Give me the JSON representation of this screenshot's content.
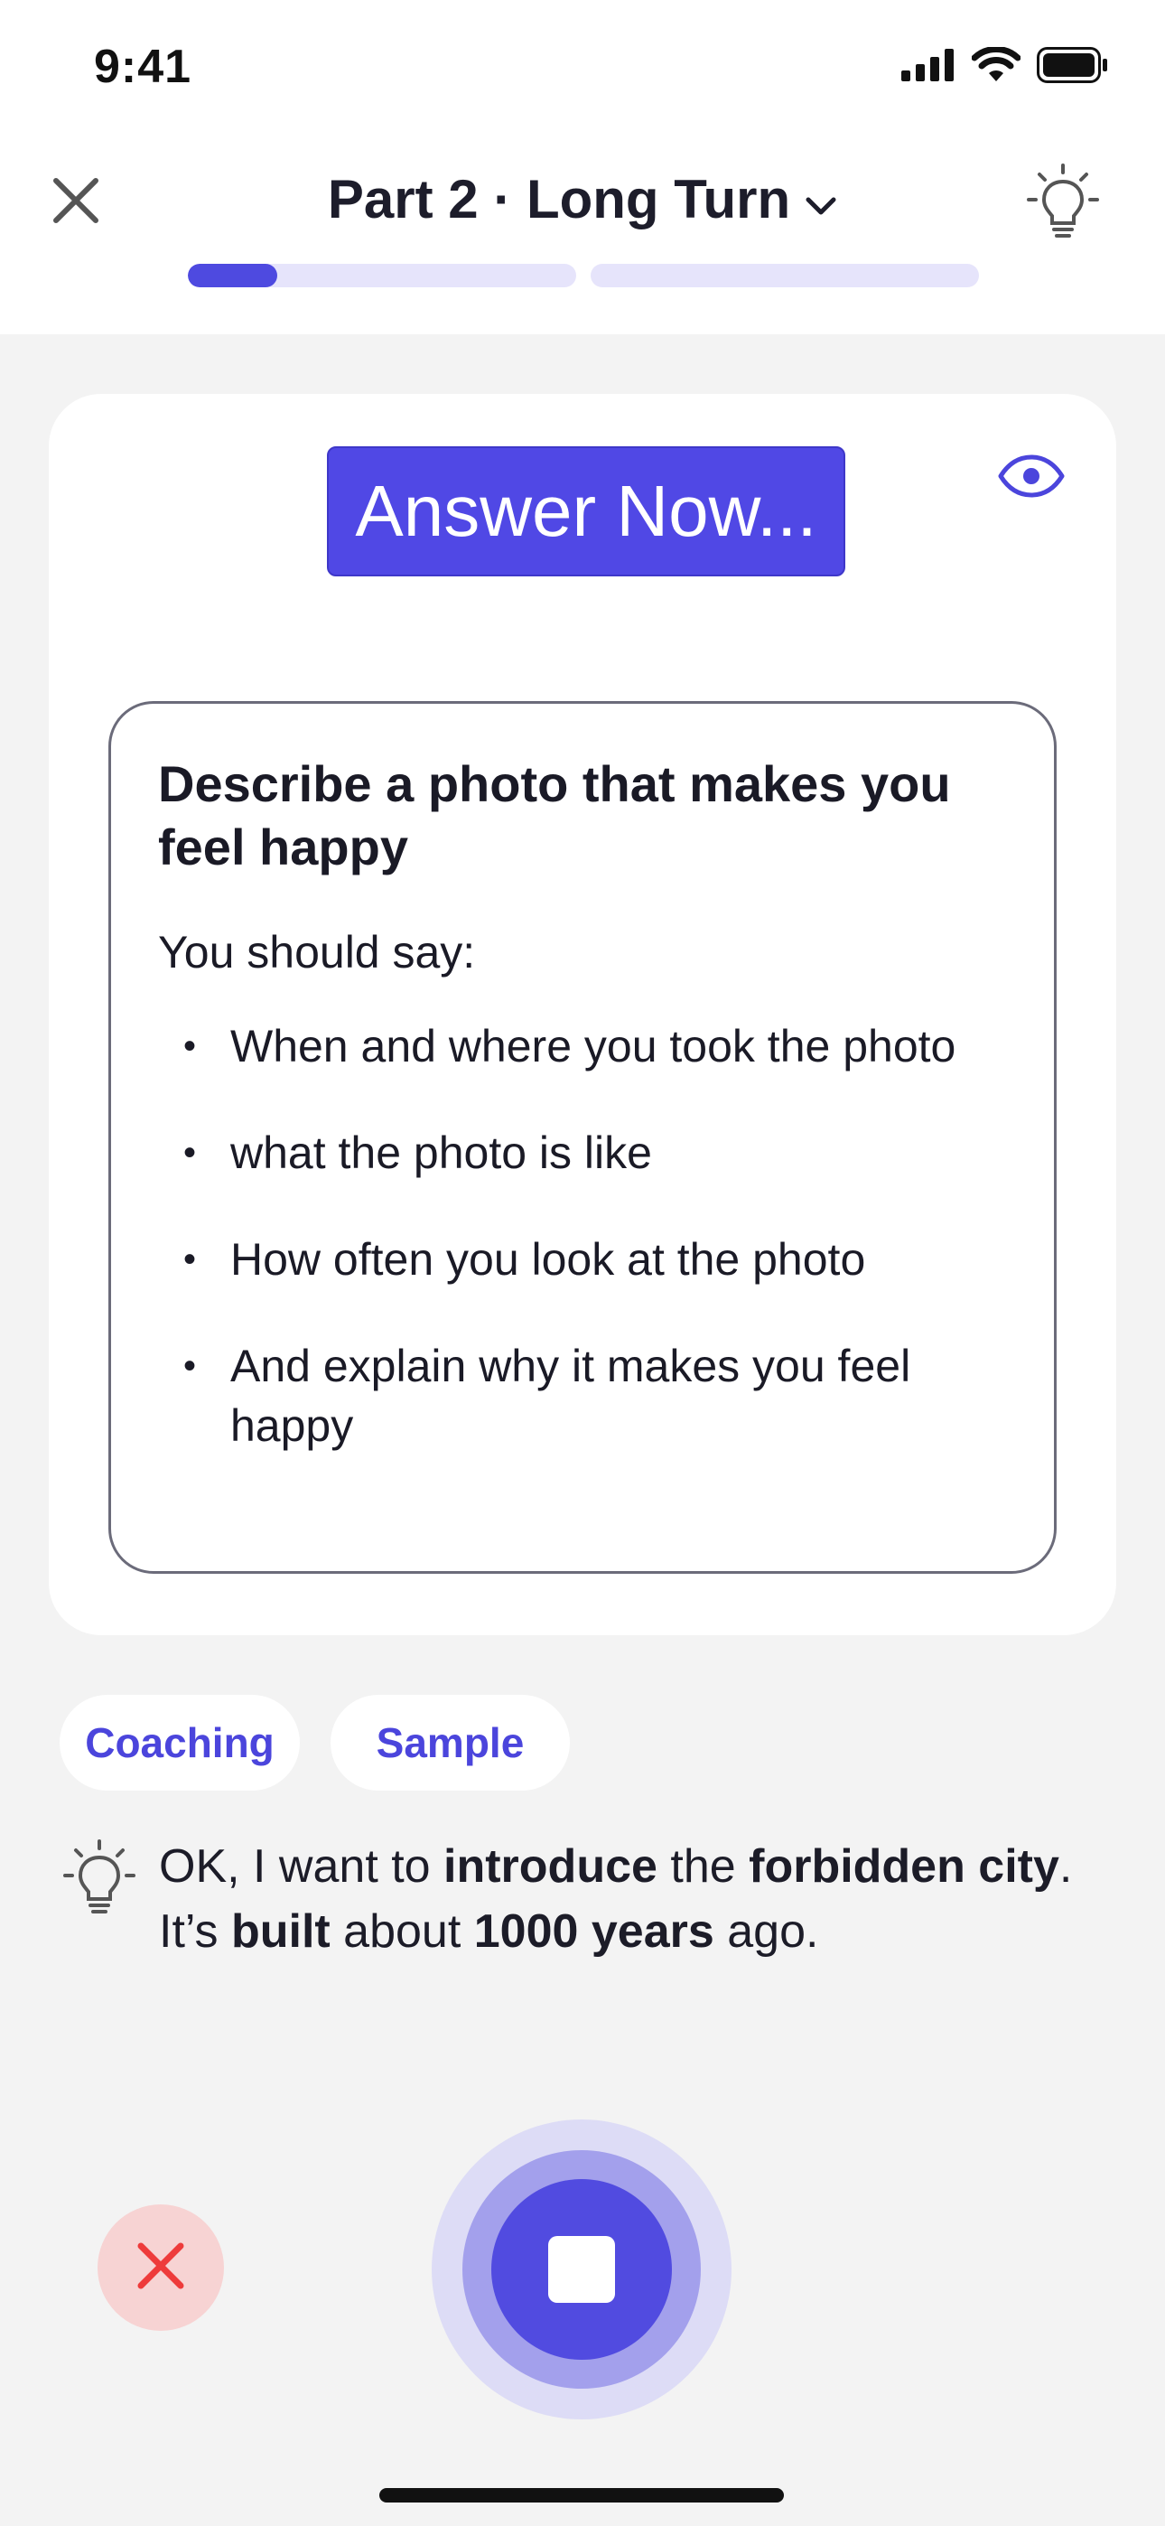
{
  "status_bar": {
    "time": "9:41",
    "icons": [
      "cellular-signal-icon",
      "wifi-icon",
      "battery-icon"
    ]
  },
  "header": {
    "title": "Part 2 · Long Turn",
    "close_icon": "close-icon",
    "dropdown_icon": "chevron-down-icon",
    "hint_icon": "lightbulb-icon",
    "progress": [
      {
        "fill_fraction": 0.23
      },
      {
        "fill_fraction": 0.0
      }
    ]
  },
  "card": {
    "answer_now_label": "Answer Now...",
    "visibility_icon": "eye-icon",
    "cue_card": {
      "title": "Describe a photo that makes you feel happy",
      "subtitle": "You should say:",
      "points": [
        "When and where you took the photo",
        "what the photo is like",
        "How often you look at the photo",
        "And explain why it makes you feel happy"
      ]
    }
  },
  "chips": {
    "coaching": "Coaching",
    "sample": "Sample"
  },
  "tip": {
    "icon": "lightbulb-icon",
    "segments": [
      {
        "text": "OK, I want to ",
        "bold": false
      },
      {
        "text": "introduce",
        "bold": true
      },
      {
        "text": " the ",
        "bold": false
      },
      {
        "text": "forbidden city",
        "bold": true
      },
      {
        "text": ". It’s ",
        "bold": false
      },
      {
        "text": "built",
        "bold": true
      },
      {
        "text": " about ",
        "bold": false
      },
      {
        "text": "1000 years",
        "bold": true
      },
      {
        "text": " ago.",
        "bold": false
      }
    ]
  },
  "controls": {
    "cancel_icon": "close-icon",
    "stop_icon": "stop-icon"
  },
  "colors": {
    "accent": "#5048e5",
    "progress_track": "#e6e4fb",
    "cancel_bg": "#f7d3d3",
    "cancel_x": "#ee3b3b",
    "background": "#f3f3f3"
  }
}
